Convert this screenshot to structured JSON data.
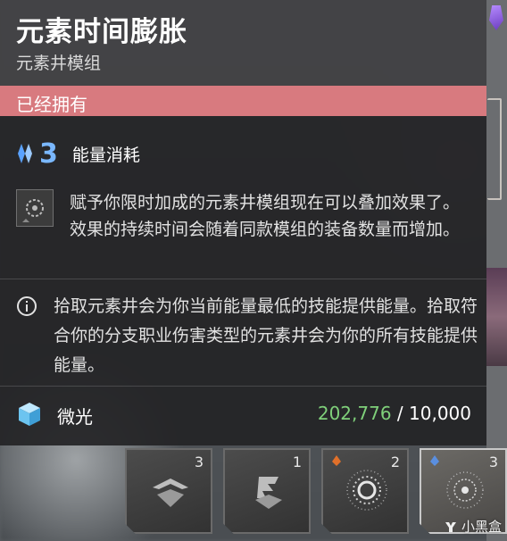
{
  "tooltip": {
    "title": "元素时间膨胀",
    "subtitle": "元素井模组",
    "owned_label": "已经拥有",
    "energy": {
      "icon": "energy-diamond-icon",
      "value": "3",
      "label": "能量消耗"
    },
    "description": {
      "icon": "mod-socket-icon",
      "text": "赋予你限时加成的元素井模组现在可以叠加效果了。效果的持续时间会随着同款模组的装备数量而增加。"
    },
    "info": {
      "icon": "info-circle-icon",
      "text": "拾取元素井会为你当前能量最低的技能提供能量。拾取符合你的分支职业伤害类型的元素井会为你的所有技能提供能量。"
    },
    "currency": {
      "icon": "glimmer-cube-icon",
      "label": "微光",
      "current": "202,776",
      "separator": " / ",
      "max": "10,000"
    }
  },
  "mod_slots": [
    {
      "cost": "3",
      "icon": "mod-glyph-icon"
    },
    {
      "cost": "1",
      "icon": "mod-glyph-icon"
    },
    {
      "cost": "2",
      "icon": "solar-burst-icon",
      "element_mark": "solar-mark-icon"
    },
    {
      "cost": "3",
      "icon": "elemental-ring-icon",
      "element_mark": "arc-mark-icon"
    }
  ],
  "watermark": {
    "text": "小黑盒"
  },
  "colors": {
    "owned_bar": "#d87a7f",
    "energy_value": "#7ab8ff",
    "glimmer_current": "#7fd07a",
    "tooltip_bg": "#242426"
  }
}
